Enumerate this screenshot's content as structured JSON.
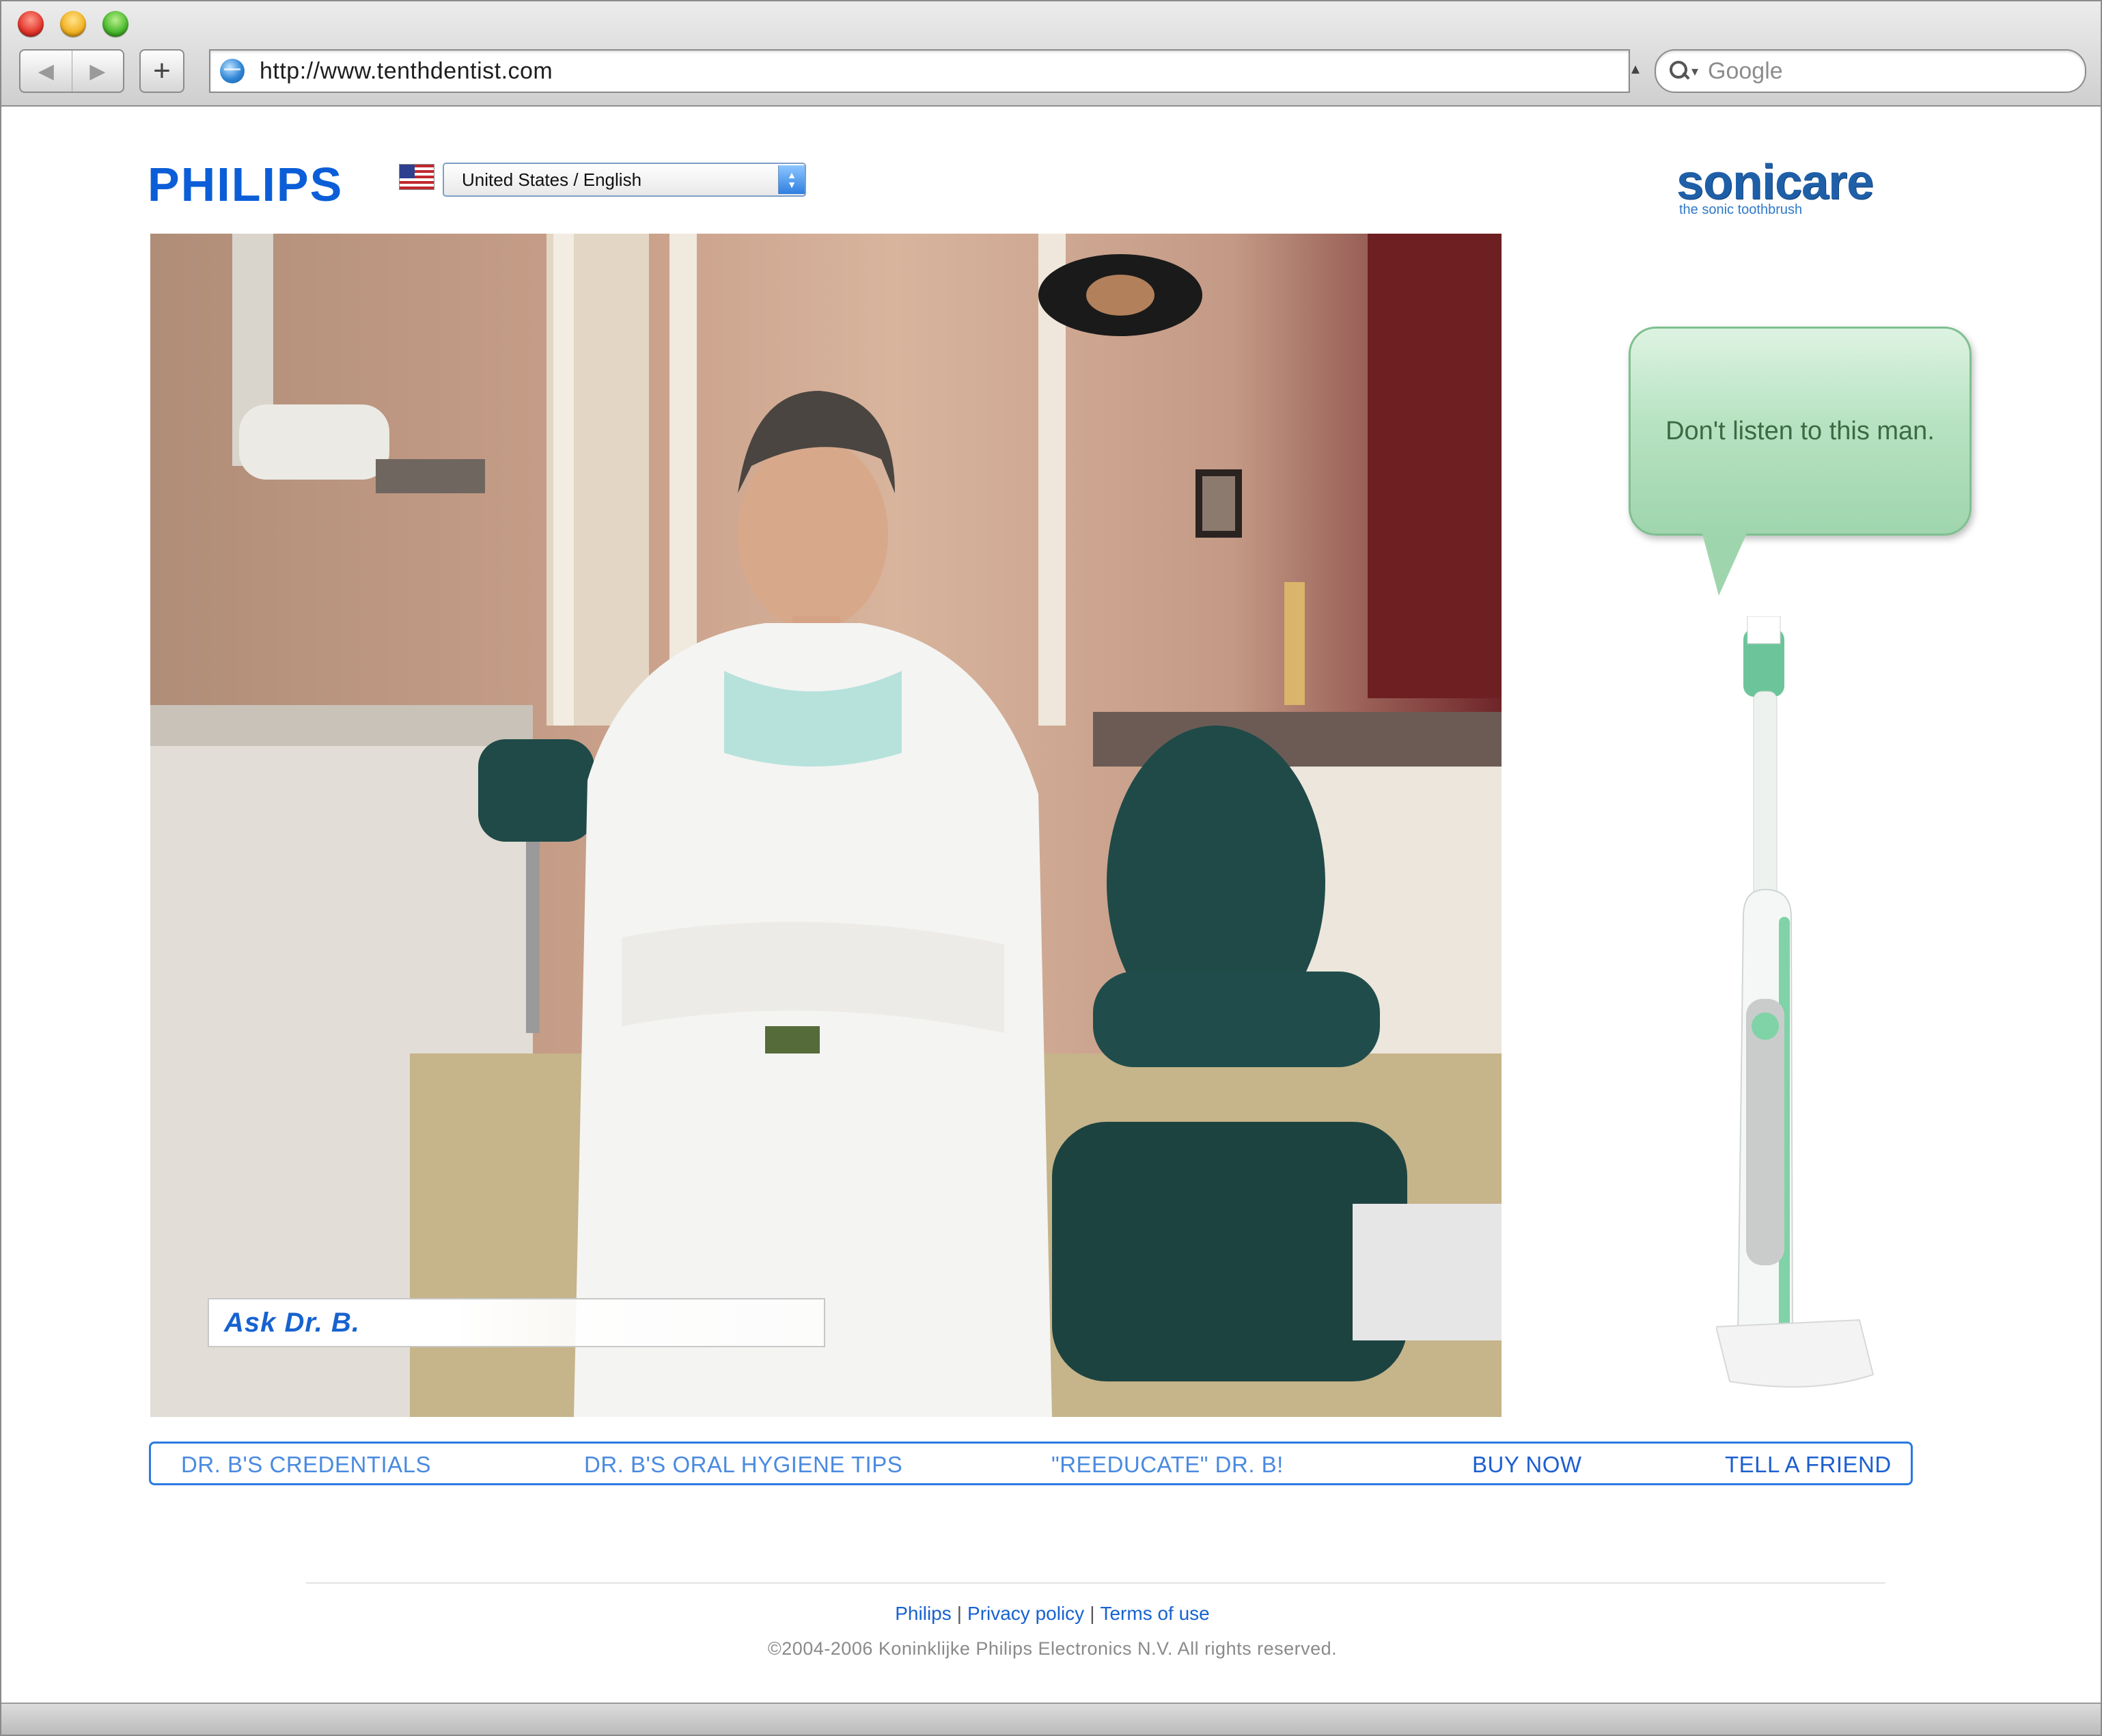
{
  "browser": {
    "url": "http://www.tenthdentist.com",
    "search_placeholder": "Google",
    "back_icon": "◀",
    "forward_icon": "▶",
    "add_icon": "+"
  },
  "header": {
    "brand": "PHILIPS",
    "country_select": "United States / English",
    "product_logo": "sonicare",
    "product_tagline": "the sonic toothbrush"
  },
  "hero": {
    "ask_label": "Ask Dr. B."
  },
  "bubble": {
    "text": "Don't listen to this man."
  },
  "nav": {
    "items": [
      "DR. B'S CREDENTIALS",
      "DR. B'S ORAL HYGIENE TIPS",
      "\"REEDUCATE\" DR. B!",
      "BUY NOW",
      "TELL A FRIEND"
    ]
  },
  "footer": {
    "links": [
      "Philips",
      "Privacy policy",
      "Terms of use"
    ],
    "separator": "|",
    "copyright": "©2004-2006 Koninklijke Philips Electronics N.V. All rights reserved."
  },
  "colors": {
    "brand_blue": "#0b5ed7",
    "nav_border": "#2a7ae0",
    "bubble_green": "#9fd5ad"
  }
}
